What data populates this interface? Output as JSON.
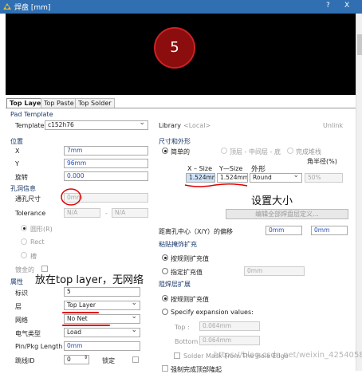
{
  "window": {
    "title": "焊盘 [mm]",
    "help": "?",
    "close": "X"
  },
  "preview": {
    "pad_label": "5"
  },
  "tabs": [
    "Top Layer",
    "Top Paste",
    "Top Solder"
  ],
  "pad_template": {
    "section": "Pad Template",
    "template_label": "Template",
    "template_value": "c152h76",
    "library_label": "Library",
    "library_value": "<Local>",
    "unlink": "Unlink"
  },
  "location": {
    "section": "位置",
    "x_label": "X",
    "x_value": "7mm",
    "y_label": "Y",
    "y_value": "96mm",
    "rotation_label": "旋转",
    "rotation_value": "0.000"
  },
  "hole": {
    "section": "孔洞信息",
    "size_label": "通孔尺寸",
    "size_value": "0mm",
    "tolerance_label": "Tolerance",
    "tol_plus": "N/A",
    "tol_sep": "-",
    "tol_minus": "N/A",
    "round": "圆形(R)",
    "rect": "Rect",
    "slot": "槽",
    "plated_label": "镀金的"
  },
  "size_shape": {
    "section": "尺寸和外形",
    "simple": "简单的",
    "top_mid_bottom": "顶层 - 中间层 - 底",
    "full_stack": "完成堆栈",
    "corner_label": "角半径(%)",
    "x_size_label": "X – Size",
    "y_size_label": "Y—Size",
    "shape_label": "外形",
    "x_size": "1.524mm",
    "y_size": "1.524mm",
    "shape_value": "Round",
    "corner_value": "50%",
    "edit_button": "编辑全部焊盘层定义...",
    "offset_label": "距离孔中心（X/Y）的偏移",
    "offset_x": "0mm",
    "offset_y": "0mm"
  },
  "paste": {
    "section": "粘贴掩饰扩充",
    "by_rule": "按规则扩充值",
    "specified": "指定扩充值",
    "specified_value": "0mm"
  },
  "solder": {
    "section": "阻焊层扩展",
    "by_rule": "按规则扩充值",
    "specify": "Specify expansion values:",
    "top_label": "Top :",
    "top_value": "0.064mm",
    "bottom_label": "Bottom :",
    "bottom_value": "0.064mm",
    "from_hole": "Solder Mask From The Hole Edge",
    "force": "强制完成顶部隆起"
  },
  "properties": {
    "section": "属性",
    "designator_label": "标识",
    "designator_value": "5",
    "layer_label": "层",
    "layer_value": "Top Layer",
    "net_label": "网络",
    "net_value": "No Net",
    "etype_label": "电气类型",
    "etype_value": "Load",
    "pinlen_label": "Pin/Pkg Length",
    "pinlen_value": "0mm",
    "jumper_label": "跳线ID",
    "jumper_value": "0",
    "locked_label": "锁定"
  },
  "annotations": {
    "setsize": "设置大小",
    "top_layer_note": "放在top layer，无网络",
    "watermark": "https://blog.csdn.net/weixin_42540580"
  },
  "colors": {
    "titlebar": "#2f6fb2",
    "pad": "#8b0d0d",
    "annotation": "#e00000"
  }
}
